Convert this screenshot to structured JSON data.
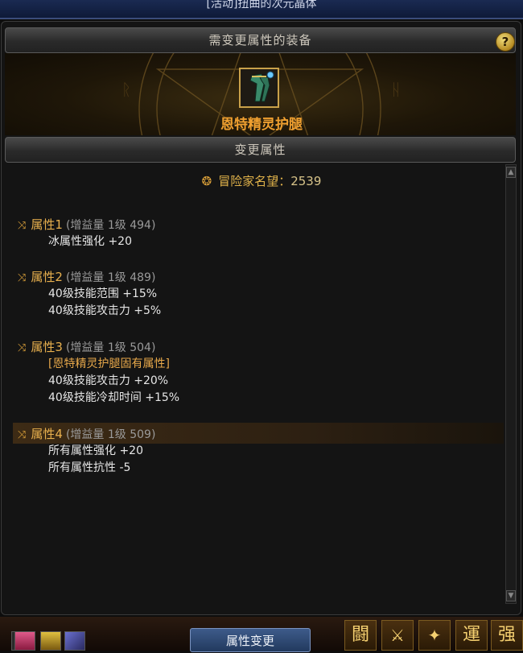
{
  "window": {
    "top_title": "[活动]扭曲的次元晶体",
    "header_equipment": "需变更属性的装备",
    "help_label": "?",
    "item_name": "恩特精灵护腿",
    "header_change": "变更属性"
  },
  "reputation": {
    "label": "冒险家名望：",
    "value": "2539"
  },
  "attributes": [
    {
      "name": "属性1",
      "meta": "(增益量 1级 494)",
      "lines": [
        "冰属性强化 +20"
      ]
    },
    {
      "name": "属性2",
      "meta": "(增益量 1级 489)",
      "lines": [
        "40级技能范围 +15%",
        "40级技能攻击力 +5%"
      ]
    },
    {
      "name": "属性3",
      "meta": "(增益量 1级 504)",
      "inherent": "[恩特精灵护腿固有属性]",
      "lines": [
        "40级技能攻击力 +20%",
        "40级技能冷却时间 +15%"
      ]
    },
    {
      "name": "属性4",
      "meta": "(增益量 1级 509)",
      "lines": [
        "所有属性强化 +20",
        "所有属性抗性 -5"
      ]
    }
  ],
  "actions": {
    "change_button": "属性变更"
  },
  "skillbar": {
    "slot_glyphs": [
      "闘",
      "運",
      "强"
    ]
  },
  "colors": {
    "accent_gold": "#e8b04e",
    "item_orange": "#f0a030",
    "button_blue": "#2f4a78"
  }
}
